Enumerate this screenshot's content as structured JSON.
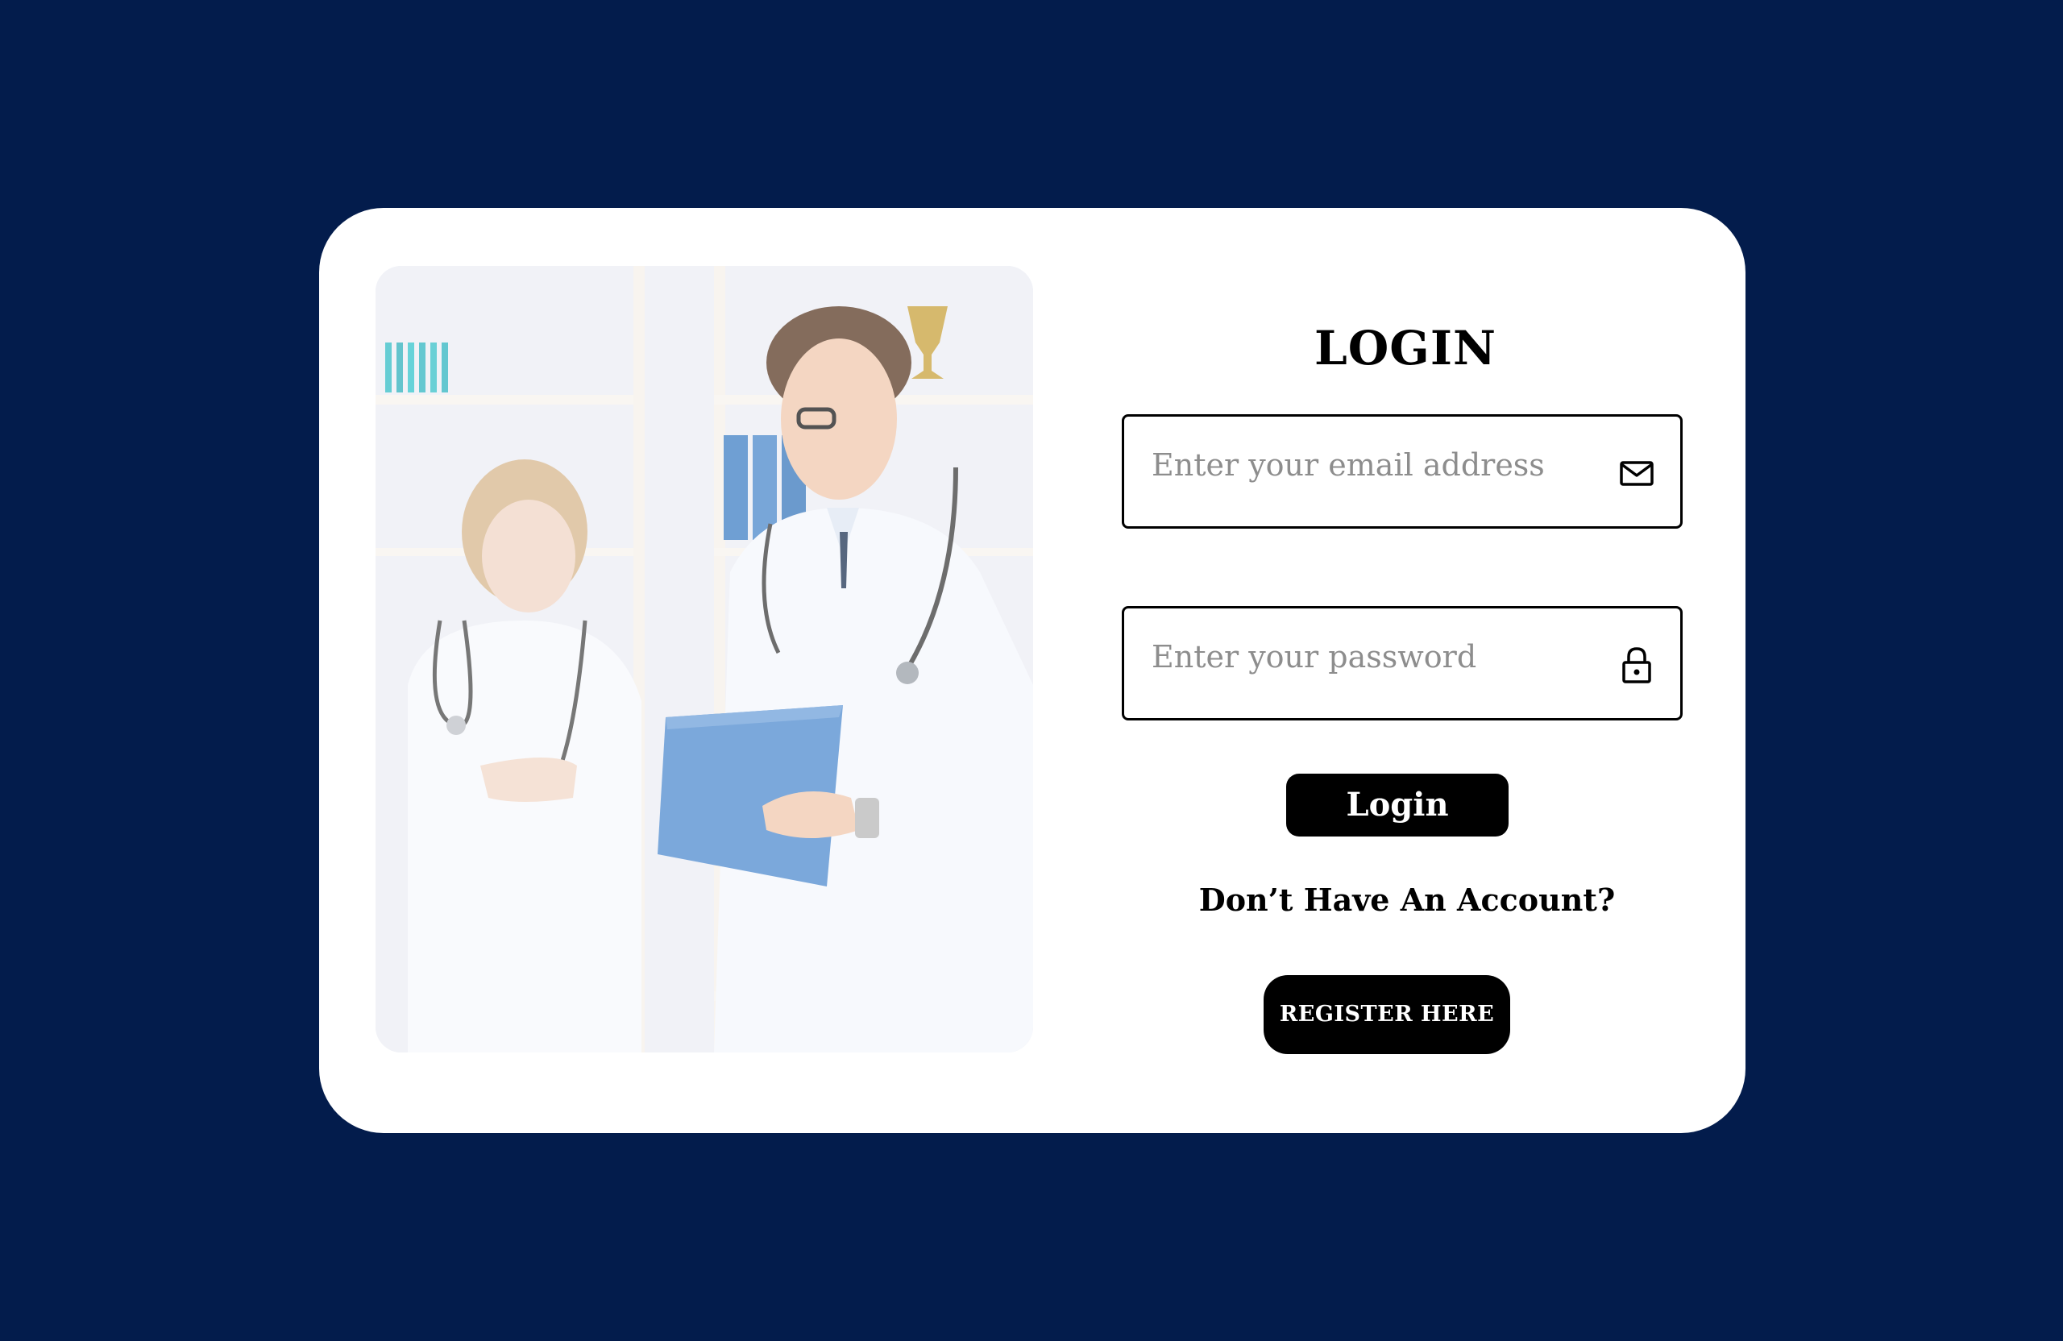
{
  "login_form": {
    "title": "LOGIN",
    "email": {
      "placeholder": "Enter your email address",
      "value": "",
      "icon": "mail-icon"
    },
    "password": {
      "placeholder": "Enter your password",
      "value": "",
      "icon": "lock-icon"
    },
    "login_label": "Login",
    "no_account_text": "Don’t Have An Account?",
    "register_label": "REGISTER HERE"
  },
  "colors": {
    "page_background": "#031c4c",
    "card_background": "#ffffff",
    "button_background": "#000000",
    "button_text": "#ffffff"
  }
}
